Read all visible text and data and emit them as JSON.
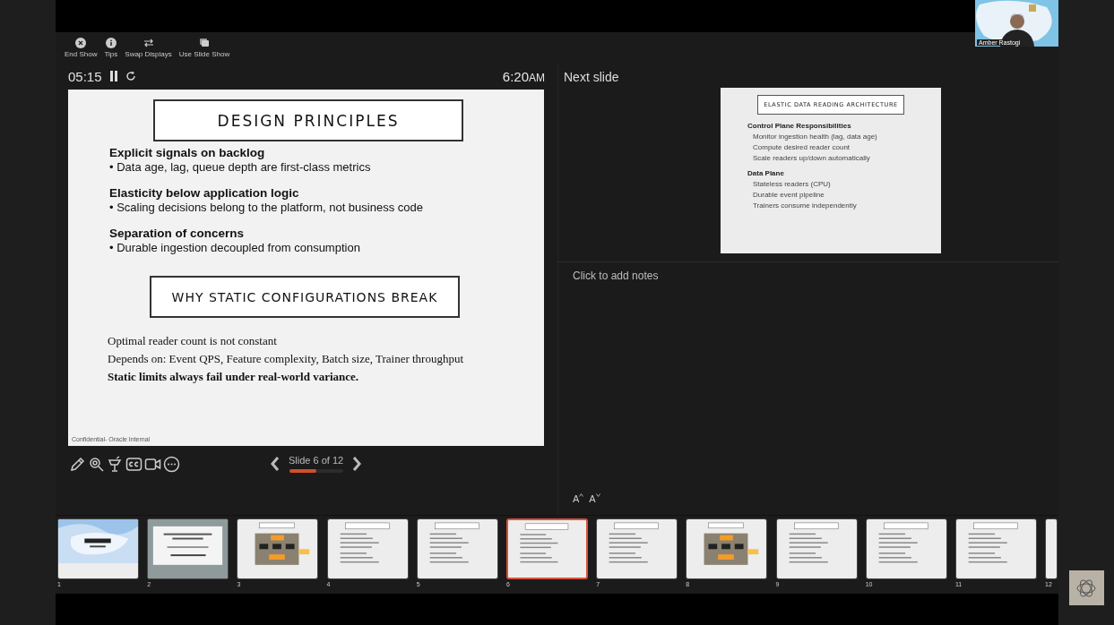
{
  "toolbar": [
    {
      "kind": "close",
      "label": "End Show"
    },
    {
      "kind": "info",
      "label": "Tips"
    },
    {
      "kind": "swap",
      "label": "Swap Displays"
    },
    {
      "kind": "slides",
      "label": "Use Slide Show"
    }
  ],
  "timer": {
    "elapsed": "05:15"
  },
  "clock": {
    "time": "6:20",
    "meridiem": "AM"
  },
  "current_slide": {
    "blocks": [
      {
        "kind": "heading",
        "text": "DESIGN PRINCIPLES"
      },
      {
        "kind": "point",
        "title": "Explicit signals on backlog",
        "detail": "• Data age, lag, queue depth are first-class metrics"
      },
      {
        "kind": "point",
        "title": "Elasticity below application logic",
        "detail": "• Scaling decisions belong to the platform, not business code"
      },
      {
        "kind": "point",
        "title": "Separation of concerns",
        "detail": "• Durable ingestion decoupled from consumption"
      },
      {
        "kind": "heading",
        "text": "WHY STATIC CONFIGURATIONS BREAK"
      },
      {
        "kind": "line",
        "text": "Optimal reader count is not constant"
      },
      {
        "kind": "line",
        "text": "Depends on: Event QPS, Feature complexity, Batch size, Trainer throughput"
      },
      {
        "kind": "strong",
        "text": "Static limits always fail under real-world variance."
      }
    ],
    "footer": "Confidential- Oracle Internal"
  },
  "slide_tools": [
    {
      "kind": "pen"
    },
    {
      "kind": "zoom"
    },
    {
      "kind": "laser"
    },
    {
      "kind": "captions"
    },
    {
      "kind": "camera"
    },
    {
      "kind": "more"
    }
  ],
  "slide_nav": {
    "label": "Slide 6 of 12",
    "level": 0.5
  },
  "next_slide": {
    "heading": "Next slide",
    "title": "ELASTIC DATA READING ARCHITECTURE",
    "groups": [
      {
        "title": "Control Plane Responsibilities",
        "bullets": [
          "Monitor ingestion health (lag, data age)",
          "Compute desired reader count",
          "Scale readers up/down automatically"
        ]
      },
      {
        "title": "Data Plane",
        "bullets": [
          "Stateless readers (CPU)",
          "Durable event pipeline",
          "Trainers consume independently"
        ]
      }
    ]
  },
  "notes": {
    "placeholder": "Click to add notes"
  },
  "font_buttons": [
    {
      "kind": "increase",
      "label": "A"
    },
    {
      "kind": "decrease",
      "label": "A"
    }
  ],
  "thumbnails": [
    {
      "number": "1",
      "kind": "cover",
      "selected": false
    },
    {
      "number": "2",
      "kind": "title",
      "selected": false
    },
    {
      "number": "3",
      "kind": "diagram",
      "selected": false
    },
    {
      "number": "4",
      "kind": "text",
      "selected": false
    },
    {
      "number": "5",
      "kind": "text",
      "selected": false
    },
    {
      "number": "6",
      "kind": "text",
      "selected": true
    },
    {
      "number": "7",
      "kind": "text",
      "selected": false
    },
    {
      "number": "8",
      "kind": "diagram",
      "selected": false
    },
    {
      "number": "9",
      "kind": "text",
      "selected": false
    },
    {
      "number": "10",
      "kind": "text",
      "selected": false
    },
    {
      "number": "11",
      "kind": "text",
      "selected": false
    },
    {
      "number": "12",
      "kind": "partial",
      "selected": false
    }
  ],
  "video": {
    "name": "Amber Rastogi"
  }
}
